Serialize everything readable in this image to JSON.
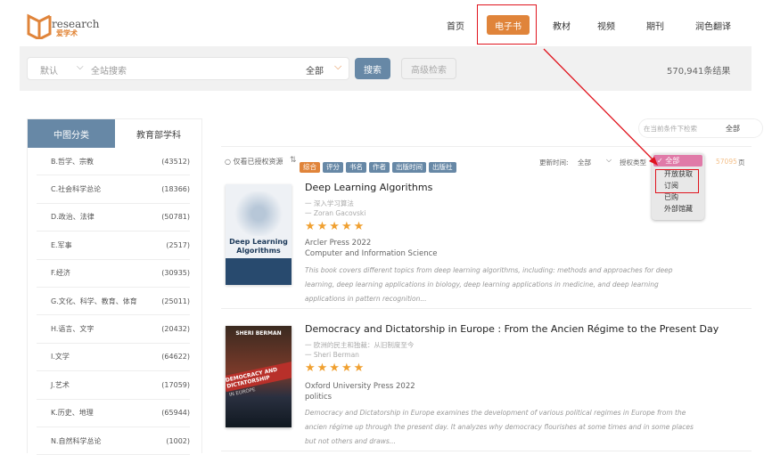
{
  "header": {
    "logo_text": "research",
    "logo_cn": "爱学术",
    "nav": [
      "首页",
      "电子书",
      "教材",
      "视频",
      "期刊",
      "润色翻译"
    ],
    "active_nav": "电子书"
  },
  "search": {
    "mode": "默认",
    "placeholder": "全站搜索",
    "scope": "全部",
    "search_label": "搜索",
    "advanced_label": "高级检索",
    "result_count": "570,941条结果"
  },
  "sidebar": {
    "tabs": [
      "中图分类",
      "教育部学科"
    ],
    "active_tab": "中图分类",
    "items": [
      {
        "label": "B.哲学、宗教",
        "count": "(43512)"
      },
      {
        "label": "C.社会科学总论",
        "count": "(18366)"
      },
      {
        "label": "D.政治、法律",
        "count": "(50781)"
      },
      {
        "label": "E.军事",
        "count": "(2517)"
      },
      {
        "label": "F.经济",
        "count": "(30935)"
      },
      {
        "label": "G.文化、科学、教育、体育",
        "count": "(25011)"
      },
      {
        "label": "H.语言、文字",
        "count": "(20432)"
      },
      {
        "label": "I.文学",
        "count": "(64622)"
      },
      {
        "label": "J.艺术",
        "count": "(17059)"
      },
      {
        "label": "K.历史、地理",
        "count": "(65944)"
      },
      {
        "label": "N.自然科学总论",
        "count": "(1002)"
      }
    ]
  },
  "filter": {
    "within_placeholder": "在当前条件下检索",
    "within_scope": "全部",
    "only_authorized": "仅看已授权资源",
    "sort_tags": [
      "综合",
      "评分",
      "书名",
      "作者",
      "出版时间",
      "出版社"
    ],
    "active_sort": "综合",
    "update_label": "更新时间:",
    "update_value": "全部",
    "auth_label": "授权类型",
    "pages": "57095",
    "pages_unit": "页",
    "auth_options": [
      "全部",
      "开放获取",
      "订阅",
      "已购",
      "外部馆藏"
    ],
    "auth_selected": "全部"
  },
  "books": [
    {
      "title": "Deep Learning Algorithms",
      "cn_title": "一 深入学习算法",
      "author": "一 Zoran Gacovski",
      "rating": 5,
      "publisher": "Arcler Press 2022",
      "subject": "Computer and Information Science",
      "desc": "This book covers different topics from deep learning algorithms, including: methods and approaches for deep learning, deep learning applications in biology, deep learning applications in medicine, and deep learning applications in pattern recognition...",
      "cover_title": "Deep Learning Algorithms"
    },
    {
      "title": "Democracy and Dictatorship in Europe : From the Ancien Régime to the Present Day",
      "cn_title": "一 欧洲的民主和独裁：从旧制度至今",
      "author": "一 Sheri Berman",
      "rating": 5,
      "publisher": "Oxford University Press 2022",
      "subject": "politics",
      "desc": "Democracy and Dictatorship in Europe examines the development of various political regimes in Europe from the ancien régime up through the present day. It analyzes why democracy flourishes at some times and in some places but not others and draws...",
      "cover_author": "SHERI BERMAN",
      "cover_title": "DEMOCRACY AND DICTATORSHIP",
      "cover_sub": "IN EUROPE"
    }
  ],
  "colors": {
    "accent": "#e0843a",
    "primary": "#6788a6",
    "annotation": "#e0141e",
    "dropdown_selected": "#e07aa8"
  }
}
